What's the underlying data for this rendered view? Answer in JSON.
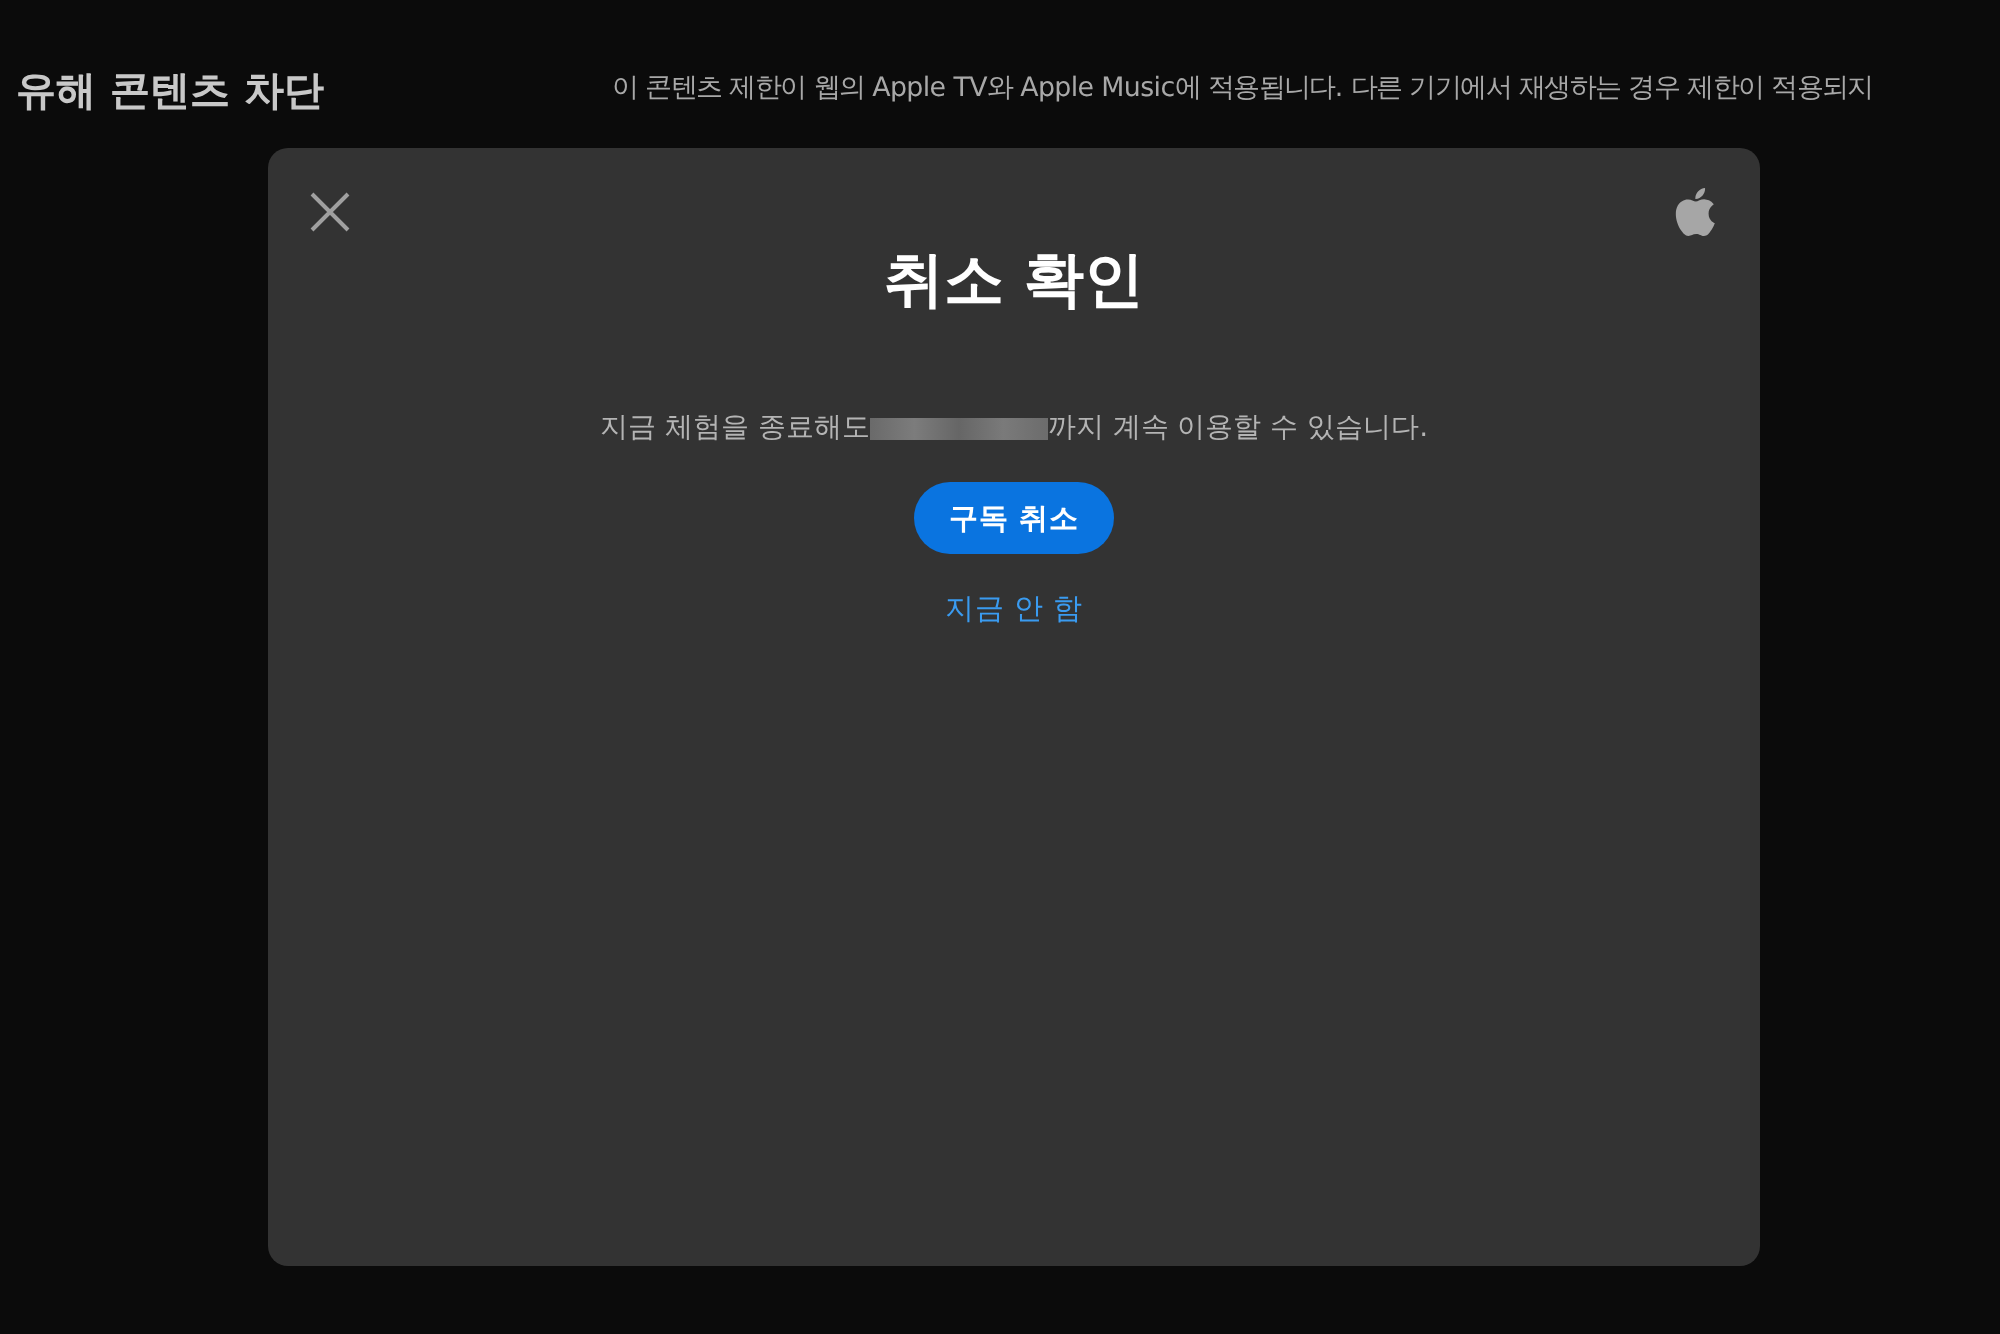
{
  "page": {
    "heading": "유해 콘텐츠 차단",
    "description": "이 콘텐츠 제한이 웹의 Apple TV와 Apple Music에 적용됩니다. 다른 기기에서 재생하는 경우 제한이 적용되지"
  },
  "dialog": {
    "title": "취소 확인",
    "message_before": "지금 체험을 종료해도",
    "date_redacted": true,
    "message_after": "까지 계속 이용할 수 있습니다.",
    "primary_button": "구독 취소",
    "secondary_link": "지금 안 함"
  }
}
